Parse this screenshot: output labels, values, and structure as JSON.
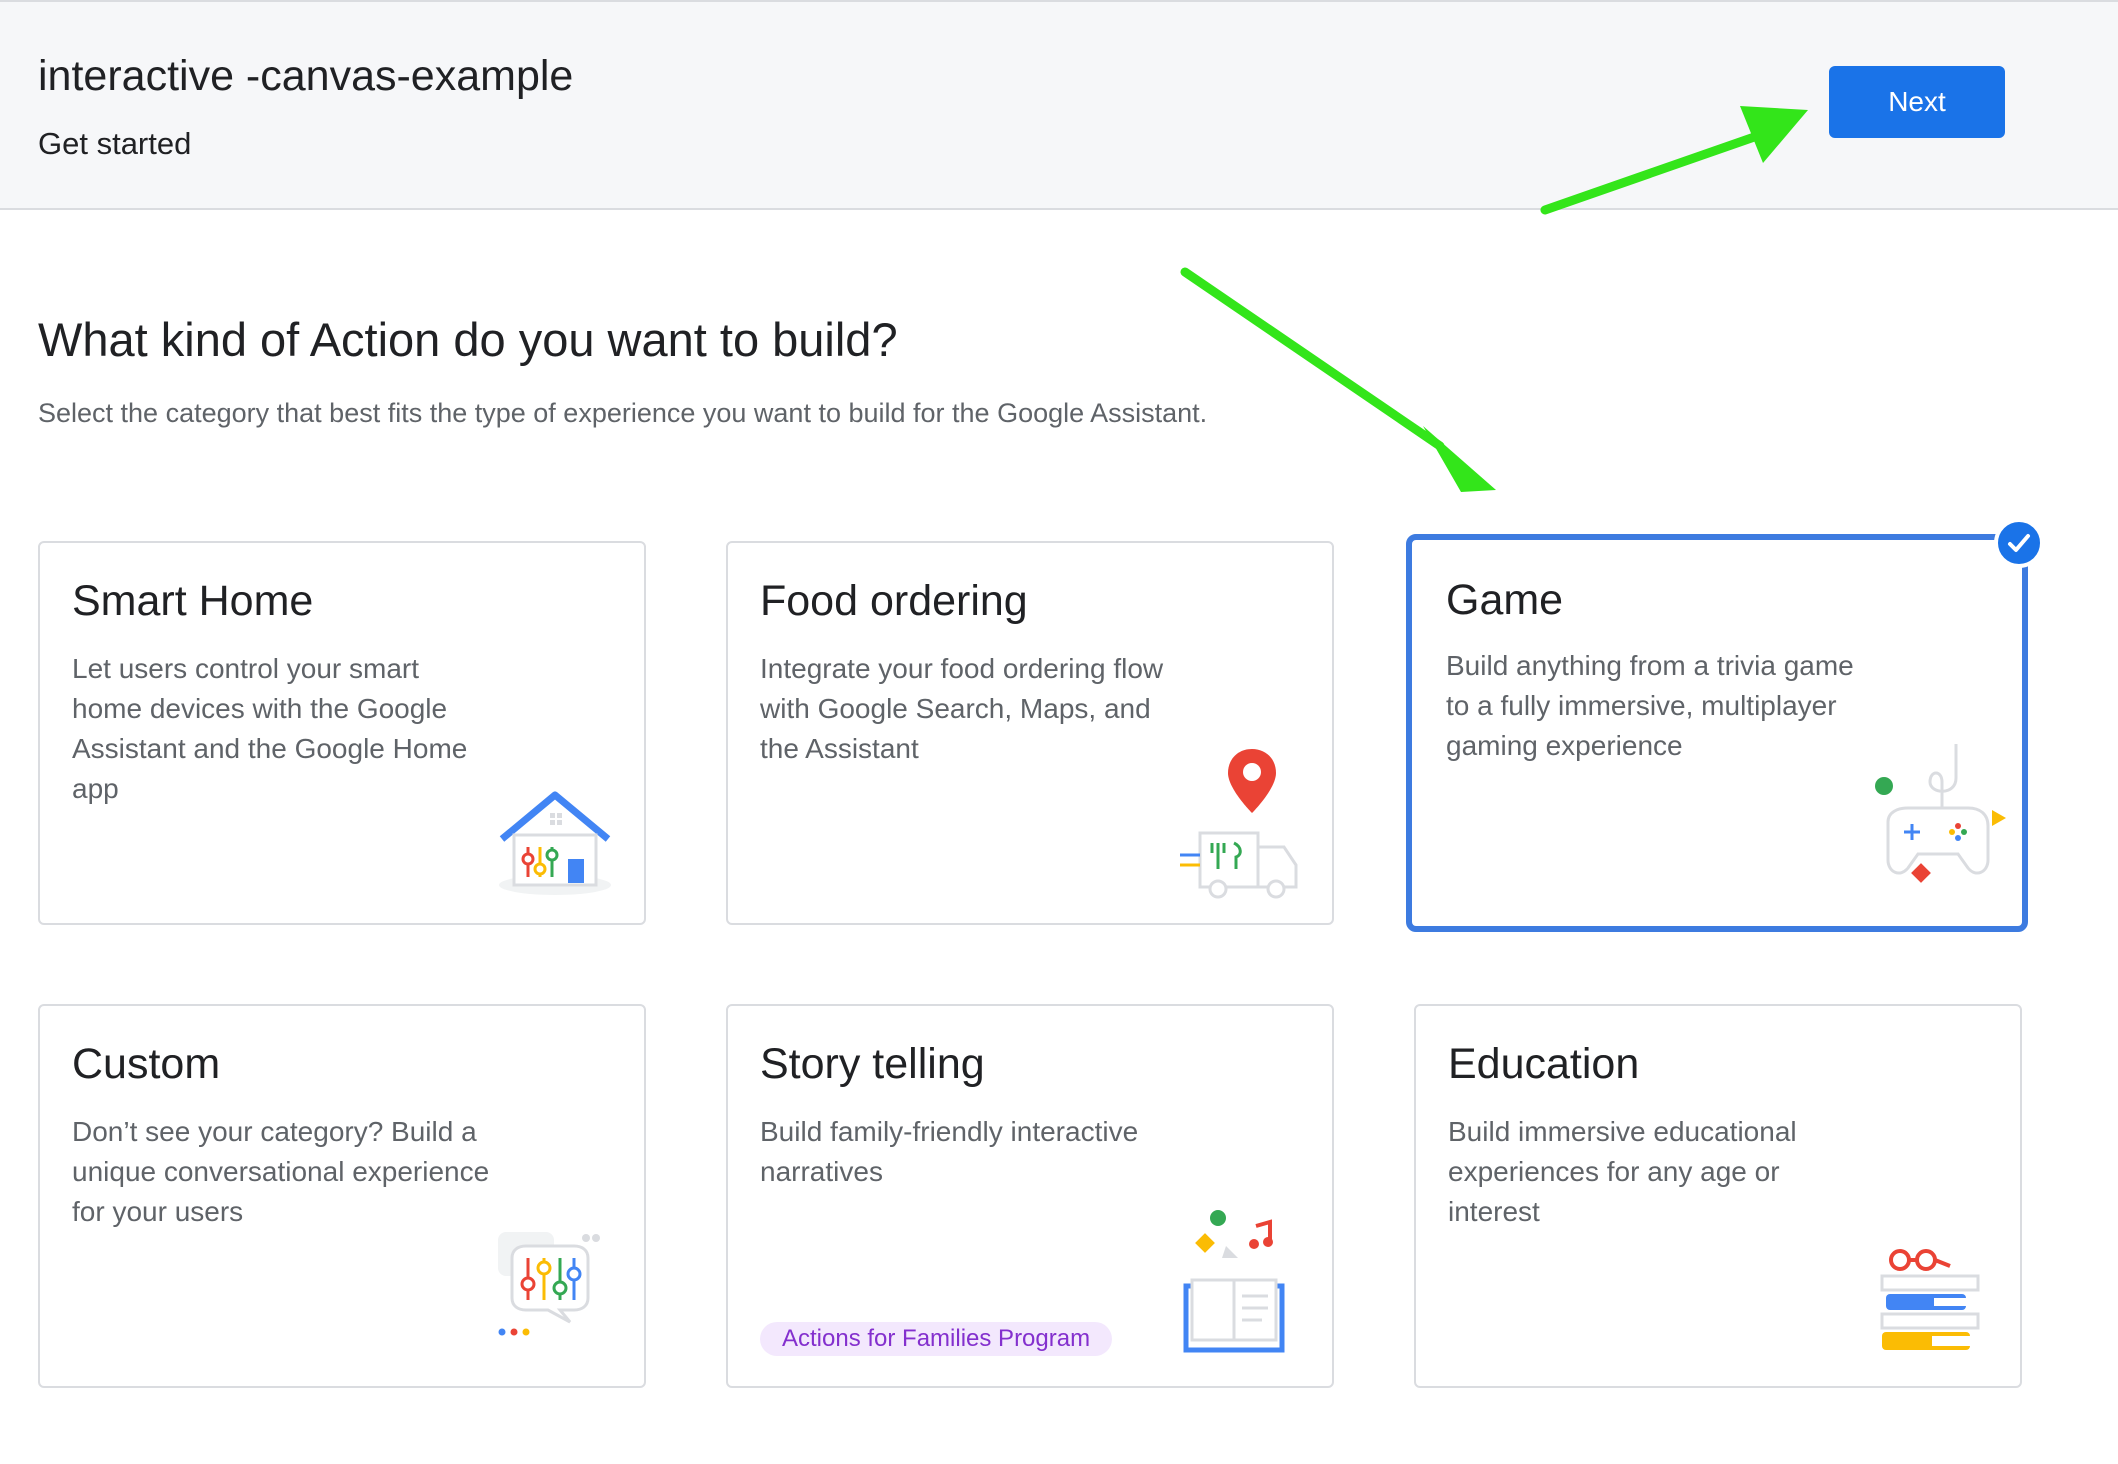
{
  "header": {
    "project_title": "interactive -canvas-example",
    "subtitle": "Get started",
    "next_label": "Next"
  },
  "main": {
    "heading": "What kind of Action do you want to build?",
    "description": "Select the category that best fits the type of experience you want to build for the Google Assistant."
  },
  "cards": [
    {
      "title": "Smart Home",
      "description": "Let users control your smart home devices with the Google Assistant and the Google Home app",
      "icon": "smart-home-icon",
      "selected": false
    },
    {
      "title": "Food ordering",
      "description": "Integrate your food ordering flow with Google Search, Maps, and the Assistant",
      "icon": "food-truck-icon",
      "selected": false
    },
    {
      "title": "Game",
      "description": "Build anything from a trivia game to a fully immersive, multiplayer gaming experience",
      "icon": "game-controller-icon",
      "selected": true
    },
    {
      "title": "Custom",
      "description": "Don’t see your category? Build a unique conversational experience for your users",
      "icon": "chat-sliders-icon",
      "selected": false
    },
    {
      "title": "Story telling",
      "description": "Build family-friendly interactive narratives",
      "badge": "Actions for Families Program",
      "icon": "open-book-icon",
      "selected": false
    },
    {
      "title": "Education",
      "description": "Build immersive educational experiences for any age or interest",
      "icon": "books-glasses-icon",
      "selected": false
    }
  ],
  "colors": {
    "accent": "#1a73e8",
    "selected_border": "#3d7be0",
    "annotation_arrow": "#33e51a",
    "badge_bg": "#f3e8fd",
    "badge_text": "#8430ce"
  }
}
